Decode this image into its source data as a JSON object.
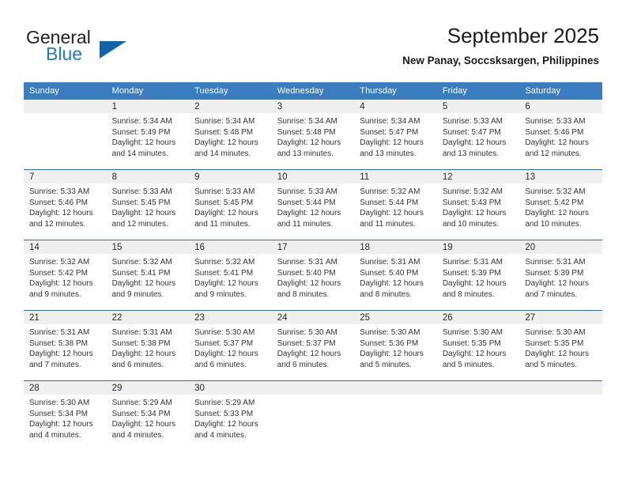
{
  "brand": {
    "name_top": "General",
    "name_bottom": "Blue",
    "triangle_color": "#1463a8",
    "blue_color": "#1f7bc1"
  },
  "header": {
    "title": "September 2025",
    "subtitle": "New Panay, Soccsksargen, Philippines"
  },
  "theme": {
    "header_blue": "#3a7dc0",
    "separator_blue": "#2e6da6",
    "day_band_gray": "#efefef"
  },
  "calendar": {
    "weekday_headers": [
      "Sunday",
      "Monday",
      "Tuesday",
      "Wednesday",
      "Thursday",
      "Friday",
      "Saturday"
    ],
    "weeks": [
      [
        {
          "day": "",
          "sunrise": "",
          "sunset": "",
          "daylight_1": "",
          "daylight_2": ""
        },
        {
          "day": "1",
          "sunrise": "Sunrise: 5:34 AM",
          "sunset": "Sunset: 5:49 PM",
          "daylight_1": "Daylight: 12 hours",
          "daylight_2": "and 14 minutes."
        },
        {
          "day": "2",
          "sunrise": "Sunrise: 5:34 AM",
          "sunset": "Sunset: 5:48 PM",
          "daylight_1": "Daylight: 12 hours",
          "daylight_2": "and 14 minutes."
        },
        {
          "day": "3",
          "sunrise": "Sunrise: 5:34 AM",
          "sunset": "Sunset: 5:48 PM",
          "daylight_1": "Daylight: 12 hours",
          "daylight_2": "and 13 minutes."
        },
        {
          "day": "4",
          "sunrise": "Sunrise: 5:34 AM",
          "sunset": "Sunset: 5:47 PM",
          "daylight_1": "Daylight: 12 hours",
          "daylight_2": "and 13 minutes."
        },
        {
          "day": "5",
          "sunrise": "Sunrise: 5:33 AM",
          "sunset": "Sunset: 5:47 PM",
          "daylight_1": "Daylight: 12 hours",
          "daylight_2": "and 13 minutes."
        },
        {
          "day": "6",
          "sunrise": "Sunrise: 5:33 AM",
          "sunset": "Sunset: 5:46 PM",
          "daylight_1": "Daylight: 12 hours",
          "daylight_2": "and 12 minutes."
        }
      ],
      [
        {
          "day": "7",
          "sunrise": "Sunrise: 5:33 AM",
          "sunset": "Sunset: 5:46 PM",
          "daylight_1": "Daylight: 12 hours",
          "daylight_2": "and 12 minutes."
        },
        {
          "day": "8",
          "sunrise": "Sunrise: 5:33 AM",
          "sunset": "Sunset: 5:45 PM",
          "daylight_1": "Daylight: 12 hours",
          "daylight_2": "and 12 minutes."
        },
        {
          "day": "9",
          "sunrise": "Sunrise: 5:33 AM",
          "sunset": "Sunset: 5:45 PM",
          "daylight_1": "Daylight: 12 hours",
          "daylight_2": "and 11 minutes."
        },
        {
          "day": "10",
          "sunrise": "Sunrise: 5:33 AM",
          "sunset": "Sunset: 5:44 PM",
          "daylight_1": "Daylight: 12 hours",
          "daylight_2": "and 11 minutes."
        },
        {
          "day": "11",
          "sunrise": "Sunrise: 5:32 AM",
          "sunset": "Sunset: 5:44 PM",
          "daylight_1": "Daylight: 12 hours",
          "daylight_2": "and 11 minutes."
        },
        {
          "day": "12",
          "sunrise": "Sunrise: 5:32 AM",
          "sunset": "Sunset: 5:43 PM",
          "daylight_1": "Daylight: 12 hours",
          "daylight_2": "and 10 minutes."
        },
        {
          "day": "13",
          "sunrise": "Sunrise: 5:32 AM",
          "sunset": "Sunset: 5:42 PM",
          "daylight_1": "Daylight: 12 hours",
          "daylight_2": "and 10 minutes."
        }
      ],
      [
        {
          "day": "14",
          "sunrise": "Sunrise: 5:32 AM",
          "sunset": "Sunset: 5:42 PM",
          "daylight_1": "Daylight: 12 hours",
          "daylight_2": "and 9 minutes."
        },
        {
          "day": "15",
          "sunrise": "Sunrise: 5:32 AM",
          "sunset": "Sunset: 5:41 PM",
          "daylight_1": "Daylight: 12 hours",
          "daylight_2": "and 9 minutes."
        },
        {
          "day": "16",
          "sunrise": "Sunrise: 5:32 AM",
          "sunset": "Sunset: 5:41 PM",
          "daylight_1": "Daylight: 12 hours",
          "daylight_2": "and 9 minutes."
        },
        {
          "day": "17",
          "sunrise": "Sunrise: 5:31 AM",
          "sunset": "Sunset: 5:40 PM",
          "daylight_1": "Daylight: 12 hours",
          "daylight_2": "and 8 minutes."
        },
        {
          "day": "18",
          "sunrise": "Sunrise: 5:31 AM",
          "sunset": "Sunset: 5:40 PM",
          "daylight_1": "Daylight: 12 hours",
          "daylight_2": "and 8 minutes."
        },
        {
          "day": "19",
          "sunrise": "Sunrise: 5:31 AM",
          "sunset": "Sunset: 5:39 PM",
          "daylight_1": "Daylight: 12 hours",
          "daylight_2": "and 8 minutes."
        },
        {
          "day": "20",
          "sunrise": "Sunrise: 5:31 AM",
          "sunset": "Sunset: 5:39 PM",
          "daylight_1": "Daylight: 12 hours",
          "daylight_2": "and 7 minutes."
        }
      ],
      [
        {
          "day": "21",
          "sunrise": "Sunrise: 5:31 AM",
          "sunset": "Sunset: 5:38 PM",
          "daylight_1": "Daylight: 12 hours",
          "daylight_2": "and 7 minutes."
        },
        {
          "day": "22",
          "sunrise": "Sunrise: 5:31 AM",
          "sunset": "Sunset: 5:38 PM",
          "daylight_1": "Daylight: 12 hours",
          "daylight_2": "and 6 minutes."
        },
        {
          "day": "23",
          "sunrise": "Sunrise: 5:30 AM",
          "sunset": "Sunset: 5:37 PM",
          "daylight_1": "Daylight: 12 hours",
          "daylight_2": "and 6 minutes."
        },
        {
          "day": "24",
          "sunrise": "Sunrise: 5:30 AM",
          "sunset": "Sunset: 5:37 PM",
          "daylight_1": "Daylight: 12 hours",
          "daylight_2": "and 6 minutes."
        },
        {
          "day": "25",
          "sunrise": "Sunrise: 5:30 AM",
          "sunset": "Sunset: 5:36 PM",
          "daylight_1": "Daylight: 12 hours",
          "daylight_2": "and 5 minutes."
        },
        {
          "day": "26",
          "sunrise": "Sunrise: 5:30 AM",
          "sunset": "Sunset: 5:35 PM",
          "daylight_1": "Daylight: 12 hours",
          "daylight_2": "and 5 minutes."
        },
        {
          "day": "27",
          "sunrise": "Sunrise: 5:30 AM",
          "sunset": "Sunset: 5:35 PM",
          "daylight_1": "Daylight: 12 hours",
          "daylight_2": "and 5 minutes."
        }
      ],
      [
        {
          "day": "28",
          "sunrise": "Sunrise: 5:30 AM",
          "sunset": "Sunset: 5:34 PM",
          "daylight_1": "Daylight: 12 hours",
          "daylight_2": "and 4 minutes."
        },
        {
          "day": "29",
          "sunrise": "Sunrise: 5:29 AM",
          "sunset": "Sunset: 5:34 PM",
          "daylight_1": "Daylight: 12 hours",
          "daylight_2": "and 4 minutes."
        },
        {
          "day": "30",
          "sunrise": "Sunrise: 5:29 AM",
          "sunset": "Sunset: 5:33 PM",
          "daylight_1": "Daylight: 12 hours",
          "daylight_2": "and 4 minutes."
        },
        {
          "day": "",
          "sunrise": "",
          "sunset": "",
          "daylight_1": "",
          "daylight_2": ""
        },
        {
          "day": "",
          "sunrise": "",
          "sunset": "",
          "daylight_1": "",
          "daylight_2": ""
        },
        {
          "day": "",
          "sunrise": "",
          "sunset": "",
          "daylight_1": "",
          "daylight_2": ""
        },
        {
          "day": "",
          "sunrise": "",
          "sunset": "",
          "daylight_1": "",
          "daylight_2": ""
        }
      ]
    ]
  }
}
